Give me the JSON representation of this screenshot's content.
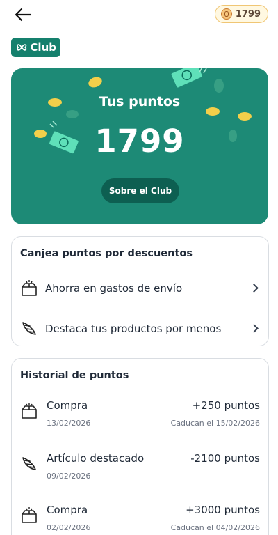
{
  "header": {
    "points_badge": "1799",
    "back_icon": "arrow-left-icon",
    "coin_icon": "coin-icon"
  },
  "club": {
    "label": "Club",
    "icon": "clover-icon",
    "color": "#15806d"
  },
  "hero": {
    "title": "Tus puntos",
    "points": "1799",
    "button_label": "Sobre el Club",
    "background": "#1d8a76"
  },
  "redeem": {
    "title": "Canjea puntos por descuentos",
    "items": [
      {
        "label": "Ahorra en gastos de envío",
        "icon": "box-icon"
      },
      {
        "label": "Destaca tus productos por menos",
        "icon": "wing-icon"
      }
    ]
  },
  "history": {
    "title": "Historial de puntos",
    "items": [
      {
        "name": "Compra",
        "date": "13/02/2026",
        "amount": "+250 puntos",
        "expiry": "Caducan el 15/02/2026",
        "icon": "box-icon"
      },
      {
        "name": "Artículo destacado",
        "date": "09/02/2026",
        "amount": "-2100 puntos",
        "expiry": "",
        "icon": "wing-icon"
      },
      {
        "name": "Compra",
        "date": "02/02/2026",
        "amount": "+3000 puntos",
        "expiry": "Caducan el 04/02/2026",
        "icon": "box-icon"
      }
    ]
  }
}
